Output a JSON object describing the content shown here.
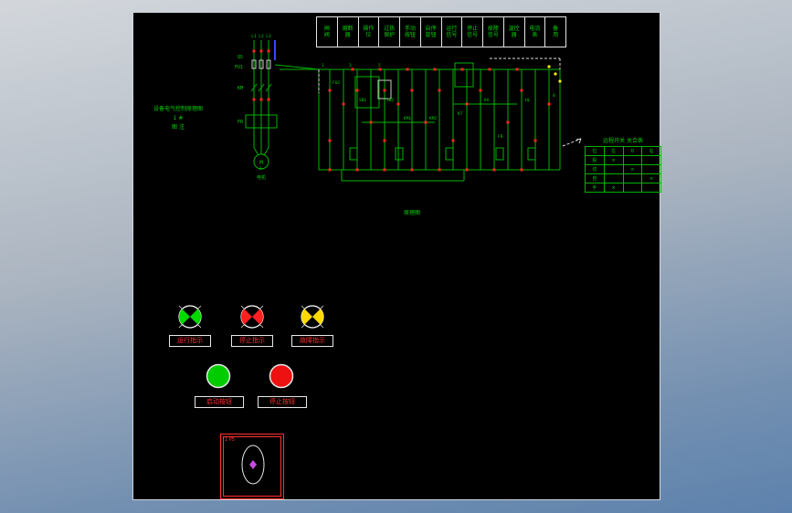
{
  "colors": {
    "wire_green": "#00b400",
    "label_green": "#00d000",
    "device_red": "#ff2222",
    "accent_blue": "#3a46ff",
    "dash_white": "#dddddd",
    "dot_yellow": "#ffee00",
    "panel_text_red": "#ff3030"
  },
  "legend": {
    "cells": [
      {
        "top": "闸",
        "bottom": "阀"
      },
      {
        "top": "熔断",
        "bottom": "器"
      },
      {
        "top": "操作",
        "bottom": "位"
      },
      {
        "top": "过热",
        "bottom": "保护"
      },
      {
        "top": "手动",
        "bottom": "按钮"
      },
      {
        "top": "启停",
        "bottom": "旋钮"
      },
      {
        "top": "运行",
        "bottom": "信号"
      },
      {
        "top": "停止",
        "bottom": "信号"
      },
      {
        "top": "故障",
        "bottom": "信号"
      },
      {
        "top": "温控",
        "bottom": "器"
      },
      {
        "top": "电流",
        "bottom": "表"
      },
      {
        "top": "备",
        "bottom": "用"
      }
    ]
  },
  "left_note": {
    "lines": [
      "设备电气控制原理图",
      "1 #",
      "图 注"
    ]
  },
  "power": {
    "phases": [
      "L1",
      "L2",
      "L3"
    ],
    "labels": {
      "qs": "QS",
      "fu": "FU1",
      "km": "KM",
      "fr": "FR"
    },
    "motor": "M",
    "motor_sub": "3~",
    "caption": "电机"
  },
  "control": {
    "labels": [
      "1",
      "3",
      "5",
      "FU2",
      "SB1",
      "SB2",
      "KM1",
      "KM2",
      "KT",
      "KA",
      "FR",
      "HL",
      "0"
    ],
    "caption": "原理图"
  },
  "right_table": {
    "title": "远程开关 关合表",
    "col_headers": [
      "位",
      "左",
      "0",
      "右"
    ],
    "rows": [
      [
        "投",
        "×",
        "",
        ""
      ],
      [
        "切",
        "",
        "×",
        ""
      ],
      [
        "自",
        "",
        "",
        "×"
      ],
      [
        "手",
        "×",
        "",
        ""
      ]
    ]
  },
  "panel": {
    "indicators": [
      {
        "label": "运行指示",
        "color": "#00d800"
      },
      {
        "label": "停止指示",
        "color": "#ff2020"
      },
      {
        "label": "故障指示",
        "color": "#ffd800"
      }
    ],
    "buttons": [
      {
        "label": "启动按钮",
        "color": "#00cc00"
      },
      {
        "label": "停止按钮",
        "color": "#ee1111"
      }
    ],
    "meter": {
      "tag": "1 P5",
      "pointer_color": "#c44ce0"
    }
  }
}
